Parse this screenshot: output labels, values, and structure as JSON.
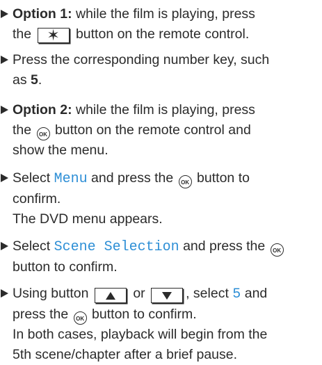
{
  "steps": [
    {
      "lead_bold": "Option 1:",
      "t1": " while the film is playing, press",
      "t2": "the ",
      "key": "✶",
      "t3": " button on the remote control."
    },
    {
      "t1": "Press the corresponding number key, such",
      "t2": "as ",
      "bold": "5",
      "t3": "."
    },
    {
      "lead_bold": "Option 2:",
      "t1": " while the film is playing, press",
      "t2": "the ",
      "ok": "OK",
      "t3": " button on the remote control and",
      "t4": "show the menu."
    },
    {
      "t1": "Select ",
      "disp": "Menu",
      "t2": " and press the ",
      "ok": "OK",
      "t3": " button to",
      "t4": "confirm.",
      "result": "The DVD menu appears."
    },
    {
      "t1": "Select ",
      "disp": "Scene Selection",
      "t2": " and press the ",
      "ok": "OK",
      "t3": "button to confirm."
    },
    {
      "t1": "Using button ",
      "t2": " or ",
      "t3": ", select ",
      "disp": "5",
      "t4": " and",
      "t5": "press the ",
      "ok": "OK",
      "t6": " button to confirm.",
      "result1": "In both cases, playback will begin from the",
      "result2": "5th scene/chapter after a brief pause."
    }
  ]
}
